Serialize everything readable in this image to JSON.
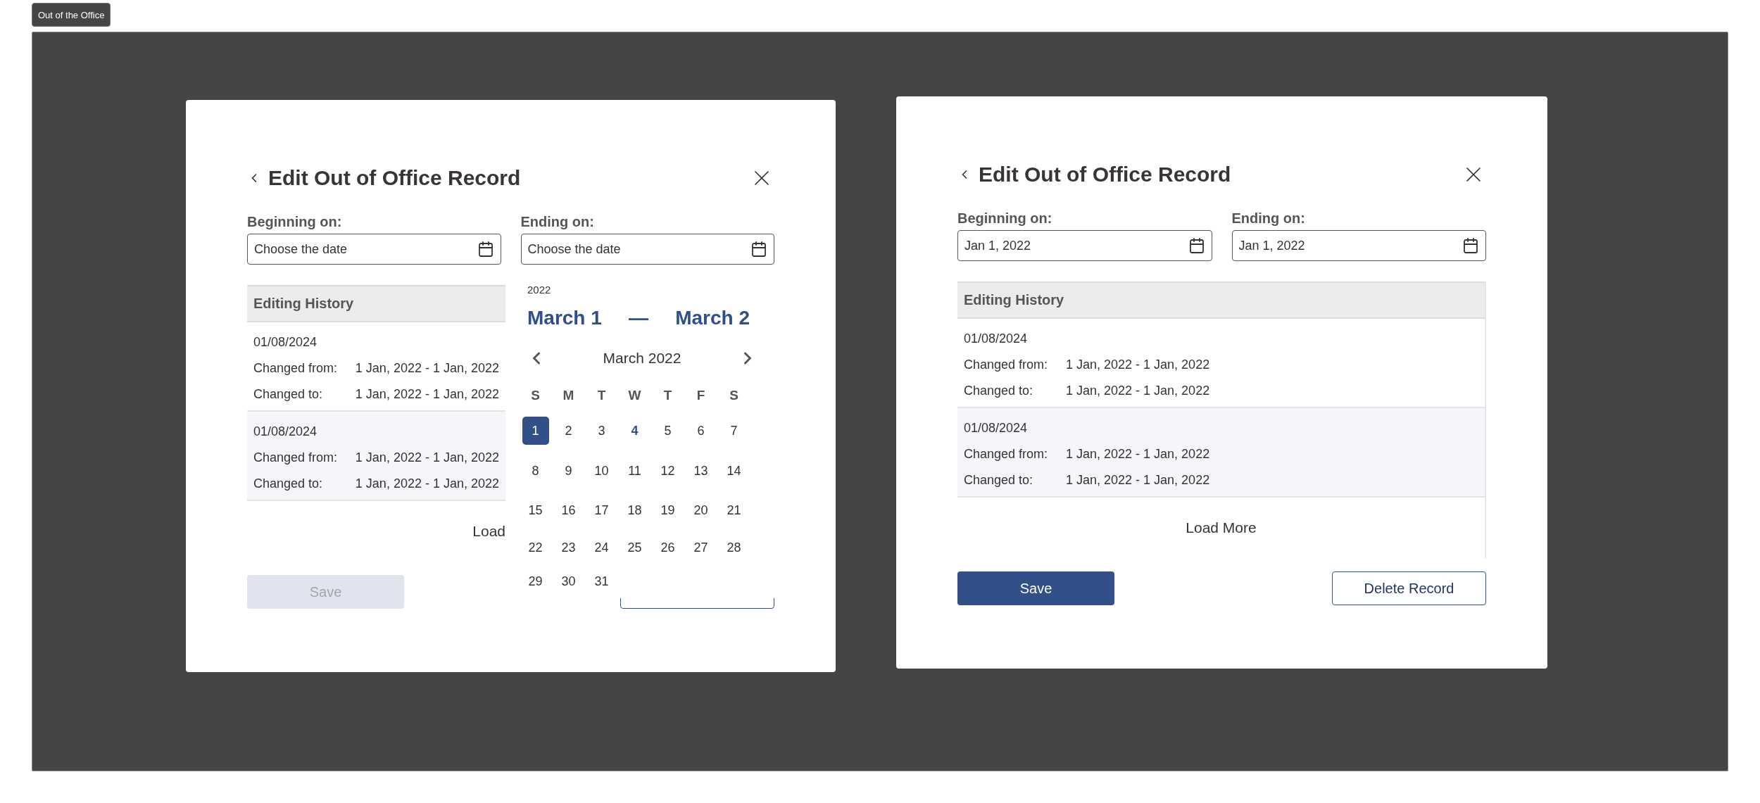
{
  "tag": {
    "label": "Out of the Office"
  },
  "dialogs": [
    {
      "title": "Edit Out of Office Record",
      "fields": [
        {
          "label": "Beginning on:",
          "placeholder": "Choose the date"
        },
        {
          "label": "Ending on:",
          "placeholder": "Choose the date"
        }
      ],
      "history": {
        "title": "Editing History",
        "entries": [
          {
            "date": "01/08/2024",
            "rows": [
              {
                "label": "Changed from:",
                "value": "1 Jan, 2022 - 1 Jan, 2022"
              },
              {
                "label": "Changed to:",
                "value": "1 Jan, 2022 - 1 Jan, 2022"
              }
            ]
          },
          {
            "date": "01/08/2024",
            "rows": [
              {
                "label": "Changed from:",
                "value": "1 Jan, 2022 - 1 Jan, 2022"
              },
              {
                "label": "Changed to:",
                "value": "1 Jan, 2022 - 1 Jan, 2022"
              }
            ]
          }
        ],
        "load_more": "Load"
      },
      "calendar": {
        "year": "2022",
        "range_start": "March 1",
        "range_separator": "—",
        "range_end": "March 2",
        "month": "March 2022",
        "weekdays": [
          "S",
          "M",
          "T",
          "W",
          "T",
          "F",
          "S"
        ],
        "days": [
          {
            "label": "1",
            "selected": true,
            "today": false
          },
          {
            "label": "2",
            "selected": false,
            "today": false
          },
          {
            "label": "3",
            "selected": false,
            "today": false
          },
          {
            "label": "4",
            "selected": false,
            "today": true
          },
          {
            "label": "5",
            "selected": false,
            "today": false
          },
          {
            "label": "6",
            "selected": false,
            "today": false
          },
          {
            "label": "7",
            "selected": false,
            "today": false
          },
          {
            "label": "8",
            "selected": false,
            "today": false
          },
          {
            "label": "9",
            "selected": false,
            "today": false
          },
          {
            "label": "10",
            "selected": false,
            "today": false
          },
          {
            "label": "11",
            "selected": false,
            "today": false
          },
          {
            "label": "12",
            "selected": false,
            "today": false
          },
          {
            "label": "13",
            "selected": false,
            "today": false
          },
          {
            "label": "14",
            "selected": false,
            "today": false
          },
          {
            "label": "15",
            "selected": false,
            "today": false
          },
          {
            "label": "16",
            "selected": false,
            "today": false
          },
          {
            "label": "17",
            "selected": false,
            "today": false
          },
          {
            "label": "18",
            "selected": false,
            "today": false
          },
          {
            "label": "19",
            "selected": false,
            "today": false
          },
          {
            "label": "20",
            "selected": false,
            "today": false
          },
          {
            "label": "21",
            "selected": false,
            "today": false
          },
          {
            "label": "22",
            "selected": false,
            "today": false
          },
          {
            "label": "23",
            "selected": false,
            "today": false
          },
          {
            "label": "24",
            "selected": false,
            "today": false
          },
          {
            "label": "25",
            "selected": false,
            "today": false
          },
          {
            "label": "26",
            "selected": false,
            "today": false
          },
          {
            "label": "27",
            "selected": false,
            "today": false
          },
          {
            "label": "28",
            "selected": false,
            "today": false
          },
          {
            "label": "29",
            "selected": false,
            "today": false
          },
          {
            "label": "30",
            "selected": false,
            "today": false
          },
          {
            "label": "31",
            "selected": false,
            "today": false
          }
        ]
      },
      "buttons": [
        {
          "label": "Save",
          "kind": "primary",
          "disabled": true
        },
        {
          "kind": "outline"
        }
      ]
    },
    {
      "title": "Edit Out of Office Record",
      "fields": [
        {
          "label": "Beginning on:",
          "value": "Jan 1, 2022"
        },
        {
          "label": "Ending on:",
          "value": "Jan 1, 2022"
        }
      ],
      "history": {
        "title": "Editing History",
        "entries": [
          {
            "date": "01/08/2024",
            "rows": [
              {
                "label": "Changed from:",
                "value": "1 Jan, 2022 - 1 Jan, 2022"
              },
              {
                "label": "Changed to:",
                "value": "1 Jan, 2022 - 1 Jan, 2022"
              }
            ]
          },
          {
            "date": "01/08/2024",
            "rows": [
              {
                "label": "Changed from:",
                "value": "1 Jan, 2022 - 1 Jan, 2022"
              },
              {
                "label": "Changed to:",
                "value": "1 Jan, 2022 - 1 Jan, 2022"
              }
            ]
          }
        ],
        "load_more": "Load More"
      },
      "buttons": [
        {
          "label": "Save",
          "kind": "primary",
          "disabled": false
        },
        {
          "label": "Delete Record",
          "kind": "outline"
        }
      ]
    }
  ]
}
